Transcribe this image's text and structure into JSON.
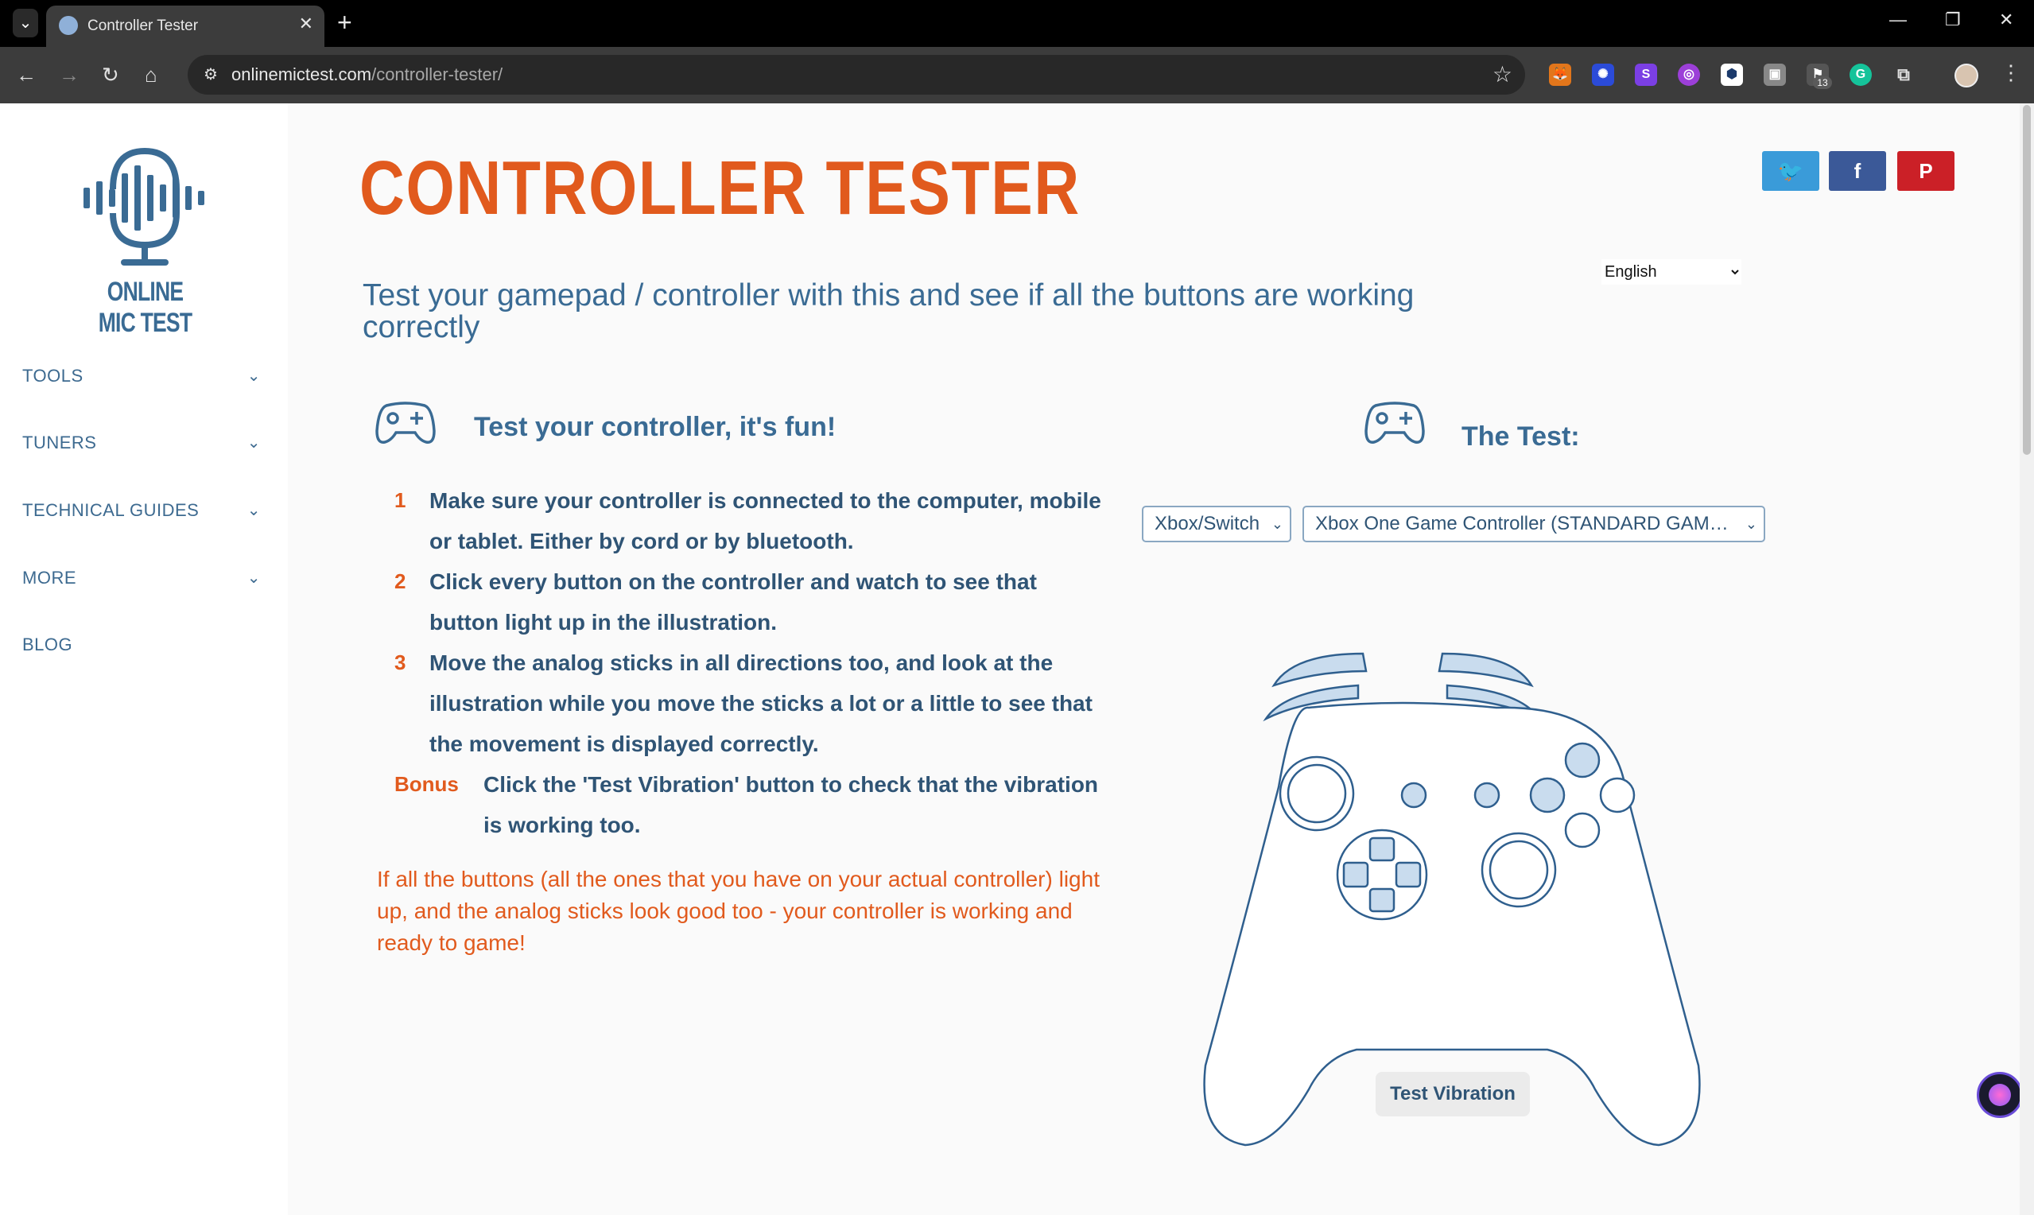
{
  "browser": {
    "tab_title": "Controller Tester",
    "tab_close": "✕",
    "new_tab": "+",
    "url_domain": "onlinemictest.com",
    "url_path": "/controller-tester/",
    "extension_badge": "13"
  },
  "sidebar": {
    "logo_text": "ONLINE MIC TEST",
    "items": [
      {
        "label": "TOOLS",
        "chevron": "⌄"
      },
      {
        "label": "TUNERS",
        "chevron": "⌄"
      },
      {
        "label": "TECHNICAL GUIDES",
        "chevron": "⌄"
      },
      {
        "label": "MORE",
        "chevron": "⌄"
      },
      {
        "label": "BLOG"
      }
    ]
  },
  "main": {
    "title": "CONTROLLER TESTER",
    "subtitle": "Test your gamepad / controller with this and see if all the buttons are working correctly",
    "language": "English",
    "share": {
      "twitter": "🐦",
      "facebook": "f",
      "pinterest": "P"
    },
    "left_heading": "Test your controller, it's fun!",
    "steps": [
      {
        "num": "1",
        "text": "Make sure your controller is connected to the computer, mobile or tablet. Either by cord or by bluetooth."
      },
      {
        "num": "2",
        "text": "Click every button on the controller and watch to see that button light up in the illustration."
      },
      {
        "num": "3",
        "text": "Move the analog sticks in all directions too, and look at the illustration while you move the sticks a lot or a little to see that the movement is displayed correctly."
      },
      {
        "num": "Bonus",
        "text": "Click the 'Test Vibration' button to check that the vibration is working too."
      }
    ],
    "note": "If all the buttons (all the ones that you have on your actual controller) light up, and the analog sticks look good too - your controller is working and ready to game!",
    "right_heading": "The Test:",
    "platform_select": "Xbox/Switch",
    "device_select": "Xbox One Game Controller (STANDARD GAM…",
    "vibration_button": "Test Vibration"
  },
  "colors": {
    "accent_orange": "#e15a1d",
    "text_blue": "#3a6b94",
    "controller_fill": "#c9dcee",
    "twitter": "#3a9bd9",
    "facebook": "#3b5998",
    "pinterest": "#cb2027"
  }
}
